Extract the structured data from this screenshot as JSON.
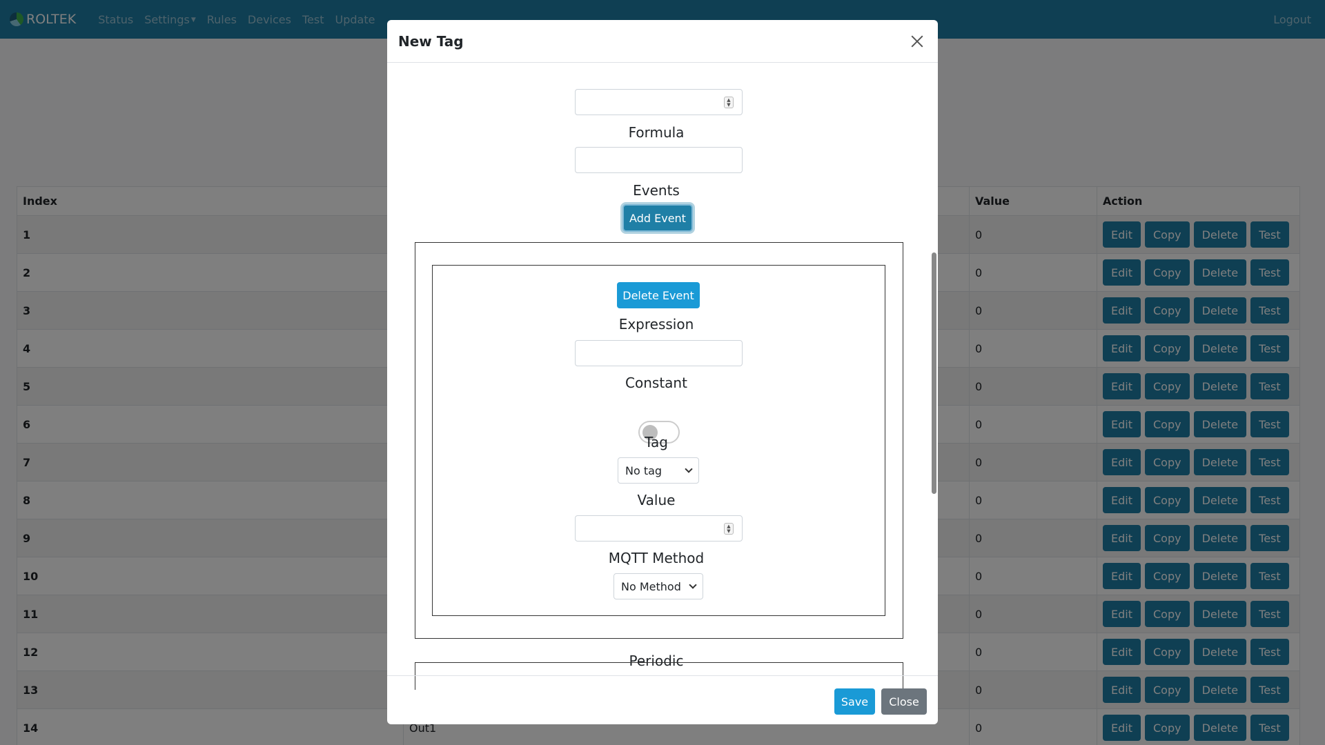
{
  "navbar": {
    "brand": "ROLTEK",
    "links": [
      "Status",
      "Settings",
      "Rules",
      "Devices",
      "Test",
      "Update"
    ],
    "logout": "Logout"
  },
  "table": {
    "headers": {
      "index": "Index",
      "value": "Value",
      "action": "Action"
    },
    "rows": [
      {
        "index": "1",
        "name": "",
        "value": "0"
      },
      {
        "index": "2",
        "name": "",
        "value": "0"
      },
      {
        "index": "3",
        "name": "",
        "value": "0"
      },
      {
        "index": "4",
        "name": "",
        "value": "0"
      },
      {
        "index": "5",
        "name": "",
        "value": "0"
      },
      {
        "index": "6",
        "name": "",
        "value": "0"
      },
      {
        "index": "7",
        "name": "",
        "value": "0"
      },
      {
        "index": "8",
        "name": "",
        "value": "0"
      },
      {
        "index": "9",
        "name": "",
        "value": "0"
      },
      {
        "index": "10",
        "name": "",
        "value": "0"
      },
      {
        "index": "11",
        "name": "",
        "value": "0"
      },
      {
        "index": "12",
        "name": "",
        "value": "0"
      },
      {
        "index": "13",
        "name": "",
        "value": "0"
      },
      {
        "index": "14",
        "name": "Out1",
        "value": "0"
      }
    ],
    "actions": [
      "Edit",
      "Copy",
      "Delete",
      "Test"
    ]
  },
  "modal": {
    "title": "New Tag",
    "formula_label": "Formula",
    "events_label": "Events",
    "add_event": "Add Event",
    "delete_event": "Delete Event",
    "expression_label": "Expression",
    "constant_label": "Constant",
    "tag_label": "Tag",
    "tag_selected": "No tag",
    "value_label": "Value",
    "mqtt_label": "MQTT Method",
    "mqtt_selected": "No Method",
    "periodic_label": "Periodic",
    "save": "Save",
    "close": "Close"
  }
}
